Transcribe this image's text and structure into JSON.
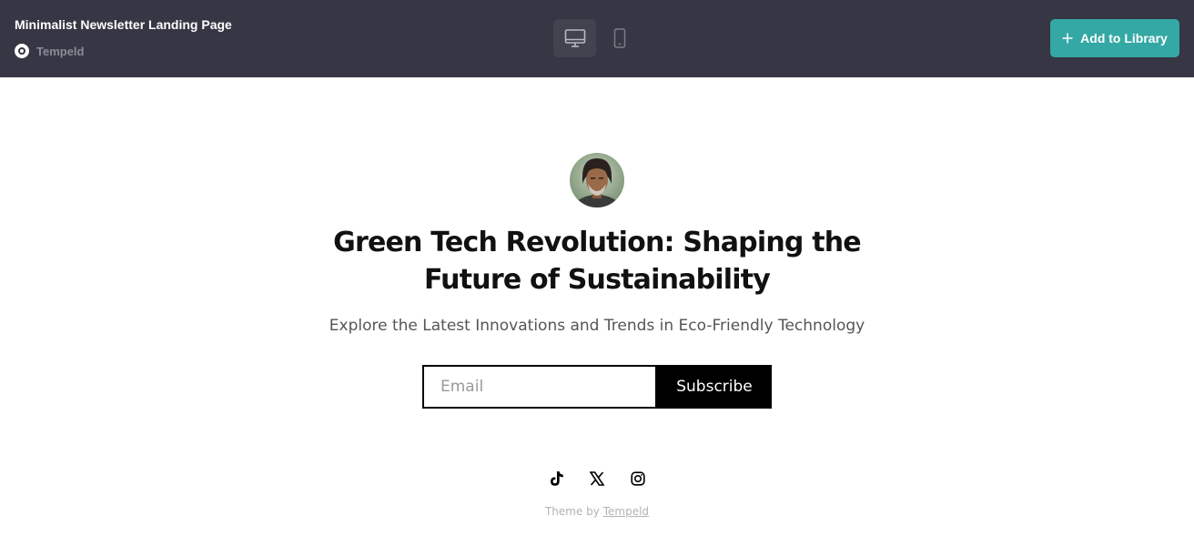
{
  "topbar": {
    "title": "Minimalist Newsletter Landing Page",
    "brand": "Tempeld",
    "brand_icon": "tempeld-logo-icon",
    "devices": [
      {
        "name": "desktop",
        "icon": "monitor-icon",
        "active": true
      },
      {
        "name": "mobile",
        "icon": "phone-icon",
        "active": false
      }
    ],
    "add_button": {
      "label": "Add to Library",
      "icon": "plus-icon"
    }
  },
  "hero": {
    "avatar": "author-avatar",
    "headline": "Green Tech Revolution: Shaping the Future of Sustainability",
    "subheadline": "Explore the Latest Innovations and Trends in Eco-Friendly Technology"
  },
  "form": {
    "email_placeholder": "Email",
    "email_value": "",
    "subscribe_label": "Subscribe"
  },
  "social": [
    {
      "name": "tiktok-icon"
    },
    {
      "name": "x-icon"
    },
    {
      "name": "instagram-icon"
    }
  ],
  "footer": {
    "prefix": "Theme by",
    "link": "Tempeld"
  },
  "colors": {
    "topbar_bg": "#363644",
    "accent": "#34a8a5",
    "button_bg": "#000000"
  }
}
